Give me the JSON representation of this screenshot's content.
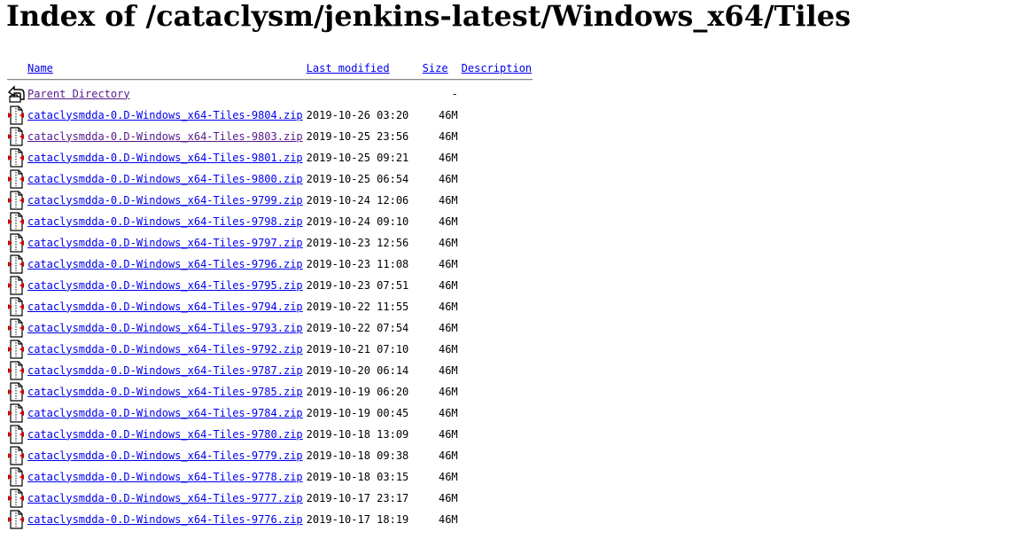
{
  "title": "Index of /cataclysm/jenkins-latest/Windows_x64/Tiles",
  "columns": {
    "name": "Name",
    "last_modified": "Last modified",
    "size": "Size",
    "description": "Description"
  },
  "parent": {
    "label": "Parent Directory",
    "size": "-",
    "icon": "back-folder-icon"
  },
  "file_icon": "compressed-file-icon",
  "files": [
    {
      "name": "cataclysmdda-0.D-Windows_x64-Tiles-9804.zip",
      "modified": "2019-10-26 03:20",
      "size": "46M"
    },
    {
      "name": "cataclysmdda-0.D-Windows_x64-Tiles-9803.zip",
      "modified": "2019-10-25 23:56",
      "size": "46M"
    },
    {
      "name": "cataclysmdda-0.D-Windows_x64-Tiles-9801.zip",
      "modified": "2019-10-25 09:21",
      "size": "46M"
    },
    {
      "name": "cataclysmdda-0.D-Windows_x64-Tiles-9800.zip",
      "modified": "2019-10-25 06:54",
      "size": "46M"
    },
    {
      "name": "cataclysmdda-0.D-Windows_x64-Tiles-9799.zip",
      "modified": "2019-10-24 12:06",
      "size": "46M"
    },
    {
      "name": "cataclysmdda-0.D-Windows_x64-Tiles-9798.zip",
      "modified": "2019-10-24 09:10",
      "size": "46M"
    },
    {
      "name": "cataclysmdda-0.D-Windows_x64-Tiles-9797.zip",
      "modified": "2019-10-23 12:56",
      "size": "46M"
    },
    {
      "name": "cataclysmdda-0.D-Windows_x64-Tiles-9796.zip",
      "modified": "2019-10-23 11:08",
      "size": "46M"
    },
    {
      "name": "cataclysmdda-0.D-Windows_x64-Tiles-9795.zip",
      "modified": "2019-10-23 07:51",
      "size": "46M"
    },
    {
      "name": "cataclysmdda-0.D-Windows_x64-Tiles-9794.zip",
      "modified": "2019-10-22 11:55",
      "size": "46M"
    },
    {
      "name": "cataclysmdda-0.D-Windows_x64-Tiles-9793.zip",
      "modified": "2019-10-22 07:54",
      "size": "46M"
    },
    {
      "name": "cataclysmdda-0.D-Windows_x64-Tiles-9792.zip",
      "modified": "2019-10-21 07:10",
      "size": "46M"
    },
    {
      "name": "cataclysmdda-0.D-Windows_x64-Tiles-9787.zip",
      "modified": "2019-10-20 06:14",
      "size": "46M"
    },
    {
      "name": "cataclysmdda-0.D-Windows_x64-Tiles-9785.zip",
      "modified": "2019-10-19 06:20",
      "size": "46M"
    },
    {
      "name": "cataclysmdda-0.D-Windows_x64-Tiles-9784.zip",
      "modified": "2019-10-19 00:45",
      "size": "46M"
    },
    {
      "name": "cataclysmdda-0.D-Windows_x64-Tiles-9780.zip",
      "modified": "2019-10-18 13:09",
      "size": "46M"
    },
    {
      "name": "cataclysmdda-0.D-Windows_x64-Tiles-9779.zip",
      "modified": "2019-10-18 09:38",
      "size": "46M"
    },
    {
      "name": "cataclysmdda-0.D-Windows_x64-Tiles-9778.zip",
      "modified": "2019-10-18 03:15",
      "size": "46M"
    },
    {
      "name": "cataclysmdda-0.D-Windows_x64-Tiles-9777.zip",
      "modified": "2019-10-17 23:17",
      "size": "46M"
    },
    {
      "name": "cataclysmdda-0.D-Windows_x64-Tiles-9776.zip",
      "modified": "2019-10-17 18:19",
      "size": "46M"
    }
  ]
}
